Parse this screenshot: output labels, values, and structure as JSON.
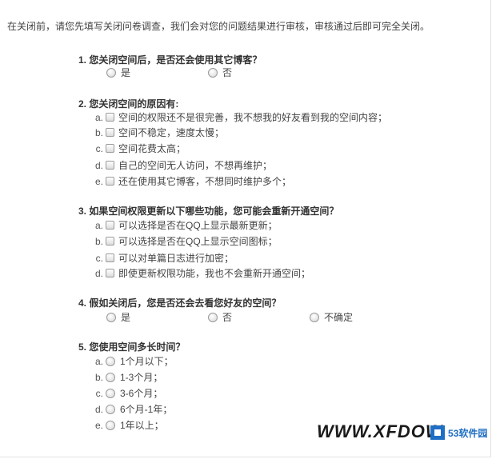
{
  "intro": "在关闭前，请您先填写关闭问卷调查，我们会对您的问题结果进行审核，审核通过后即可完全关闭。",
  "questions": [
    {
      "title": "1. 您关闭空间后，是否还会使用其它博客？",
      "options": [
        {
          "label": "是"
        },
        {
          "label": "否"
        }
      ]
    },
    {
      "title": "2. 您关闭空间的原因有:",
      "options": [
        {
          "letter": "a.",
          "label": "空间的权限还不是很完善，我不想我的好友看到我的空间内容；"
        },
        {
          "letter": "b.",
          "label": "空间不稳定，速度太慢；"
        },
        {
          "letter": "c.",
          "label": "空间花费太高；"
        },
        {
          "letter": "d.",
          "label": "自己的空间无人访问，不想再维护；"
        },
        {
          "letter": "e.",
          "label": "还在使用其它博客，不想同时维护多个；"
        }
      ]
    },
    {
      "title": "3. 如果空间权限更新以下哪些功能，您可能会重新开通空间？",
      "options": [
        {
          "letter": "a.",
          "label": "可以选择是否在QQ上显示最新更新；"
        },
        {
          "letter": "b.",
          "label": "可以选择是否在QQ上显示空间图标；"
        },
        {
          "letter": "c.",
          "label": "可以对单篇日志进行加密；"
        },
        {
          "letter": "d.",
          "label": "即使更新权限功能，我也不会重新开通空间；"
        }
      ]
    },
    {
      "title": "4. 假如关闭后，您是否还会去看您好友的空间？",
      "options": [
        {
          "label": "是"
        },
        {
          "label": "否"
        },
        {
          "label": "不确定"
        }
      ]
    },
    {
      "title": "5. 您使用空间多长时间？",
      "options": [
        {
          "letter": "a.",
          "label": "1个月以下；"
        },
        {
          "letter": "b.",
          "label": "1-3个月；"
        },
        {
          "letter": "c.",
          "label": "3-6个月；"
        },
        {
          "letter": "d.",
          "label": "6个月-1年；"
        },
        {
          "letter": "e.",
          "label": "1年以上；"
        }
      ]
    }
  ],
  "watermark": "WWW.XFDOW",
  "logo": {
    "name": "53软件园",
    "icon": "logo-square-icon"
  }
}
